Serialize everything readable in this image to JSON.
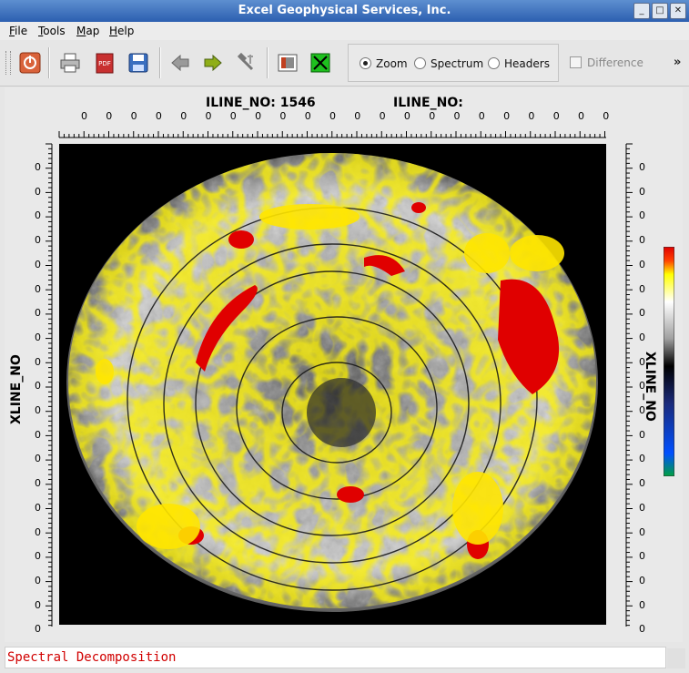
{
  "window": {
    "title": "Excel Geophysical Services, Inc."
  },
  "menu": [
    "File",
    "Tools",
    "Map",
    "Help"
  ],
  "toolbar": {
    "icons": [
      "power-icon",
      "print-icon",
      "pdf-icon",
      "save-icon",
      "back-arrow-icon",
      "forward-arrow-icon",
      "tools-icon",
      "image-icon",
      "close-x-icon"
    ],
    "radio": [
      {
        "label": "Zoom",
        "selected": true
      },
      {
        "label": "Spectrum",
        "selected": false
      },
      {
        "label": "Headers",
        "selected": false
      }
    ],
    "difference_label": "Difference",
    "overflow": "»"
  },
  "plot": {
    "top_title_left": "ILINE_NO: 1546",
    "top_title_right": "ILINE_NO:",
    "left_axis_title": "XLINE_NO",
    "right_axis_title": "XLINE_NO",
    "top_tick_labels": [
      "0",
      "0",
      "0",
      "0",
      "0",
      "0",
      "0",
      "0",
      "0",
      "0",
      "0",
      "0",
      "0",
      "0",
      "0",
      "0",
      "0",
      "0",
      "0",
      "0",
      "0",
      "0"
    ],
    "left_tick_labels": [
      "0",
      "0",
      "0",
      "0",
      "0",
      "0",
      "0",
      "0",
      "0",
      "0",
      "0",
      "0",
      "0",
      "0",
      "0",
      "0",
      "0",
      "0",
      "0",
      "0"
    ],
    "right_tick_labels": [
      "0",
      "0",
      "0",
      "0",
      "0",
      "0",
      "0",
      "0",
      "0",
      "0",
      "0",
      "0",
      "0",
      "0",
      "0",
      "0",
      "0",
      "0",
      "0",
      "0"
    ],
    "colorbar": [
      "#e00000",
      "#ff4000",
      "#ffff00",
      "#ffffff",
      "#a0a0a0",
      "#000000",
      "#1a2a7a",
      "#0050ff",
      "#00a040"
    ]
  },
  "status": {
    "text": "Spectral Decomposition"
  }
}
